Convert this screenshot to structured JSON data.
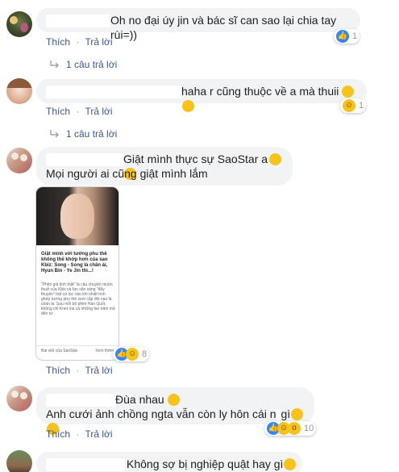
{
  "actions": {
    "like_label": "Thích",
    "reply_label": "Trả lời",
    "dot": "·"
  },
  "comments": [
    {
      "text": "Oh no đại úy jin và bác sĩ can sao lại chia tay rùi=))",
      "reaction_count": "1",
      "replies_label": "1 câu trả lời"
    },
    {
      "text": "haha r cũng thuộc về a mà thuii",
      "reaction_count": "1",
      "replies_label": "1 câu trả lời"
    },
    {
      "line1": "Giật mình thực sự SaoStar a",
      "line2": "Mọi người ai cũng giật mình lắm",
      "reaction_count": "8",
      "card": {
        "headline": "Giật mình với tướng phu thê không thể khớp hơn của sao Kbiz: Song - Song là chân ái, Hyun Bin - Ye Jin thì...!",
        "body": "\"Phim giả tình thật\" là câu chuyện muôn thuở của Kbiz và fan sẵn sàng \"đẩy thuyền\" bất cứ lúc nào khi nhiệt tình ghép tướng phu thê xem cặp đôi nào là chân ái. Sau mỗi bộ phim Hàn Quốc không chỉ Knet mà cả những fan hâm mộ đến từ",
        "footer_left": "Bài viết của SaoStar",
        "footer_right": "Xem thêm"
      }
    },
    {
      "line1": "Đùa nhau",
      "line2": "Anh cưới ảnh chồng ngta vẫn còn ly hôn cái n",
      "line2_tail": "gì",
      "reaction_count": "10"
    },
    {
      "text": "Không sợ bị nghiệp quật hay gì"
    }
  ]
}
